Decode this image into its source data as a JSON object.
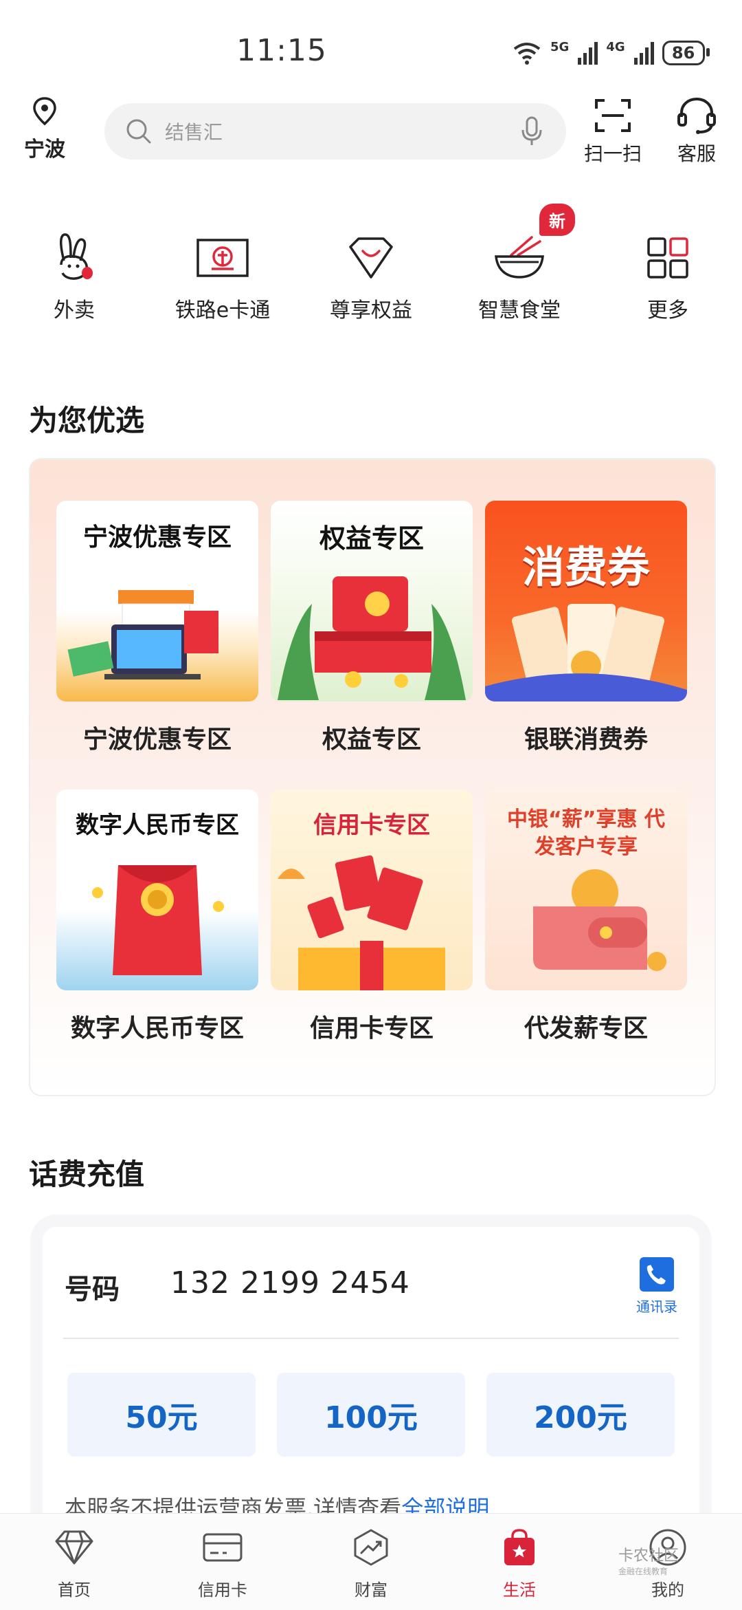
{
  "status_bar": {
    "time": "11:15",
    "network_1": "5G",
    "network_2": "4G",
    "battery": "86"
  },
  "header": {
    "location": "宁波",
    "search_placeholder": "结售汇",
    "scan_label": "扫一扫",
    "service_label": "客服"
  },
  "quick_nav": {
    "new_badge": "新",
    "items": [
      {
        "label": "外卖",
        "icon": "rabbit-icon"
      },
      {
        "label": "铁路e卡通",
        "icon": "railway-card-icon"
      },
      {
        "label": "尊享权益",
        "icon": "diamond-badge-icon"
      },
      {
        "label": "智慧食堂",
        "icon": "noodle-bowl-icon"
      },
      {
        "label": "更多",
        "icon": "grid-more-icon"
      }
    ]
  },
  "featured": {
    "title": "为您优选",
    "cards": [
      {
        "title": "宁波优惠专区",
        "image_text": "宁波优惠专区"
      },
      {
        "title": "权益专区",
        "image_text": "权益专区"
      },
      {
        "title": "银联消费券",
        "image_text": "消费券"
      },
      {
        "title": "数字人民币专区",
        "image_text": "数字人民币专区"
      },
      {
        "title": "信用卡专区",
        "image_text": "信用卡专区"
      },
      {
        "title": "代发薪专区",
        "image_text": "中银“薪”享惠 代发客户专享"
      }
    ]
  },
  "recharge": {
    "title": "话费充值",
    "phone_label": "号码",
    "phone_value": "132 2199 2454",
    "contacts_label": "通讯录",
    "amounts": [
      "50元",
      "100元",
      "200元"
    ],
    "notice_text": "本服务不提供运营商发票,详情查看",
    "notice_link": "全部说明"
  },
  "tabbar": {
    "items": [
      {
        "label": "首页",
        "icon": "diamond-icon",
        "active": false
      },
      {
        "label": "信用卡",
        "icon": "credit-card-icon",
        "active": false
      },
      {
        "label": "财富",
        "icon": "chart-trend-icon",
        "active": false
      },
      {
        "label": "生活",
        "icon": "shopping-bag-icon",
        "active": true
      },
      {
        "label": "我的",
        "icon": "user-icon",
        "active": false
      }
    ]
  },
  "watermark": {
    "line1": "卡农社区",
    "line2": "金融在线教育"
  },
  "colors": {
    "accent": "#d8233a",
    "link": "#1e6ee0",
    "amount": "#1565c7"
  }
}
